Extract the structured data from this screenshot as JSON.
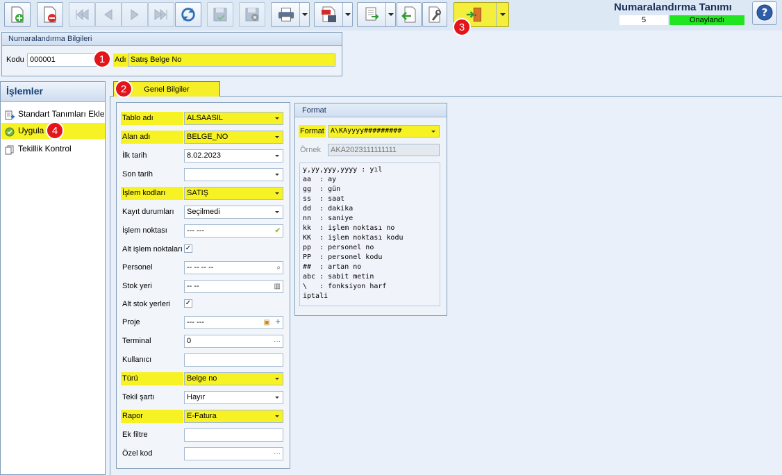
{
  "app": {
    "title": "Numaralandırma Tanımı",
    "status_number": "5",
    "status_text": "Onaylandı"
  },
  "toolbar": {
    "icons": [
      "new-doc-icon",
      "delete-doc-icon",
      "first-icon",
      "prev-icon",
      "next-icon",
      "last-icon",
      "refresh-icon",
      "save-icon",
      "save-close-icon",
      "print-icon",
      "pdf-save-icon",
      "export-icon",
      "back-icon",
      "tools-icon",
      "exit-door-icon",
      "help-icon"
    ]
  },
  "badges": [
    "1",
    "2",
    "3",
    "4"
  ],
  "info_group": {
    "title": "Numaralandırma Bilgileri",
    "code_label": "Kodu",
    "code_value": "000001",
    "name_label": "Adı",
    "name_value": "Satış Belge No"
  },
  "sidebar": {
    "title": "İşlemler",
    "items": [
      {
        "label": "Standart Tanımları Ekle"
      },
      {
        "label": "Uygula"
      },
      {
        "label": "Tekillik Kontrol"
      }
    ]
  },
  "tab": {
    "label": "Genel Bilgiler"
  },
  "form": {
    "fields": [
      {
        "label": "Tablo adı",
        "value": "ALSAASIL"
      },
      {
        "label": "Alan adı",
        "value": "BELGE_NO"
      },
      {
        "label": "İlk tarih",
        "value": "8.02.2023"
      },
      {
        "label": "Son tarih",
        "value": ""
      },
      {
        "label": "İşlem kodları",
        "value": "SATIŞ"
      },
      {
        "label": "Kayıt durumları",
        "value": "Seçilmedi"
      },
      {
        "label": "İşlem noktası",
        "value": "--- ---"
      },
      {
        "label": "Alt işlem noktaları",
        "value": "✓"
      },
      {
        "label": "Personel",
        "value": "-- -- -- --"
      },
      {
        "label": "Stok yeri",
        "value": "-- --"
      },
      {
        "label": "Alt stok yerleri",
        "value": "✓"
      },
      {
        "label": "Proje",
        "value": "--- ---"
      },
      {
        "label": "Terminal",
        "value": "0"
      },
      {
        "label": "Kullanıcı",
        "value": ""
      },
      {
        "label": "Türü",
        "value": "Belge no"
      },
      {
        "label": "Tekil şartı",
        "value": "Hayır"
      },
      {
        "label": "Rapor",
        "value": "E-Fatura"
      },
      {
        "label": "Ek filtre",
        "value": ""
      },
      {
        "label": "Özel kod",
        "value": ""
      }
    ]
  },
  "format": {
    "title": "Format",
    "format_label": "Format",
    "format_value": "A\\KAyyyy#########",
    "example_label": "Örnek",
    "example_value": "AKA2023111111111",
    "legend": [
      "y,yy,yyy,yyyy : yıl",
      "aa  : ay",
      "gg  : gün",
      "ss  : saat",
      "dd  : dakika",
      "nn  : saniye",
      "kk  : işlem noktası no",
      "KK  : işlem noktası kodu",
      "pp  : personel no",
      "PP  : personel kodu",
      "##  : artan no",
      "abc : sabit metin",
      "\\   : fonksiyon harf",
      "iptali"
    ]
  },
  "colors": {
    "highlight": "#f7f224",
    "status_ok": "#22e522",
    "badge": "#e3141a",
    "title": "#1b2e57"
  }
}
